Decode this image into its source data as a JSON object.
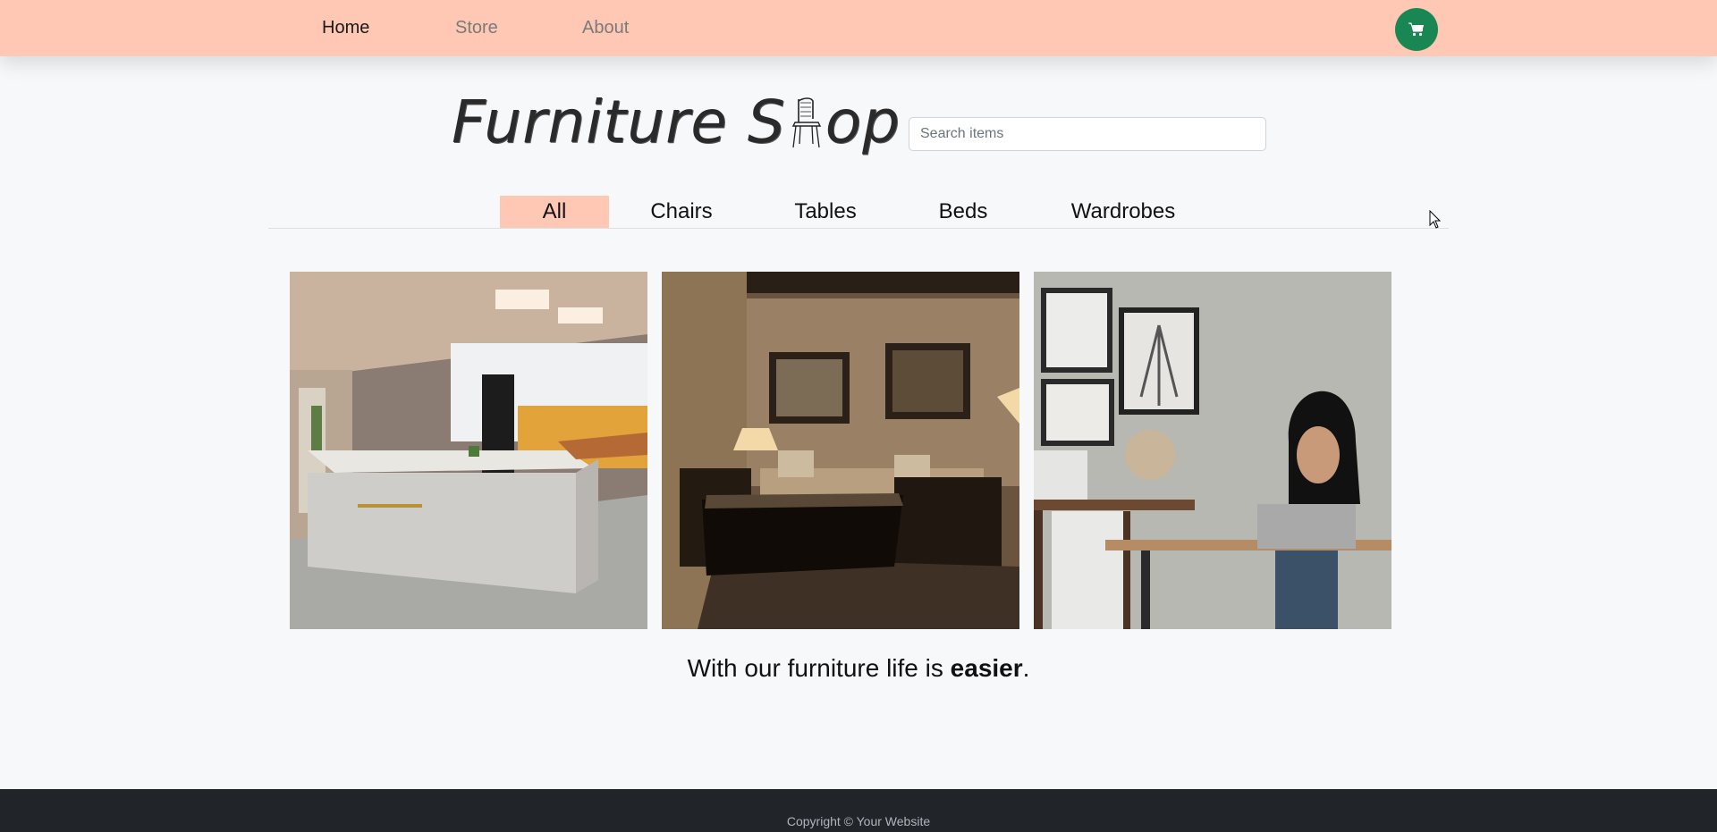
{
  "nav": {
    "items": [
      {
        "label": "Home",
        "active": true
      },
      {
        "label": "Store",
        "active": false
      },
      {
        "label": "About",
        "active": false
      }
    ],
    "cart_icon": "shopping-cart-icon",
    "cart_color": "#198754"
  },
  "header": {
    "logo_text_left": "Furniture S",
    "logo_text_right": "op",
    "logo_icon": "chair-icon",
    "search_placeholder": "Search items",
    "search_value": ""
  },
  "categories": {
    "items": [
      "All",
      "Chairs",
      "Tables",
      "Beds",
      "Wardrobes"
    ],
    "active": "All",
    "accent": "#ffc8b4"
  },
  "gallery": {
    "images": [
      {
        "name": "kitchen-photo"
      },
      {
        "name": "living-room-photo"
      },
      {
        "name": "home-office-photo"
      }
    ]
  },
  "tagline": {
    "prefix": "With our furniture life is ",
    "emphasis": "easier",
    "suffix": "."
  },
  "footer": {
    "copyright": "Copyright © Your Website"
  }
}
